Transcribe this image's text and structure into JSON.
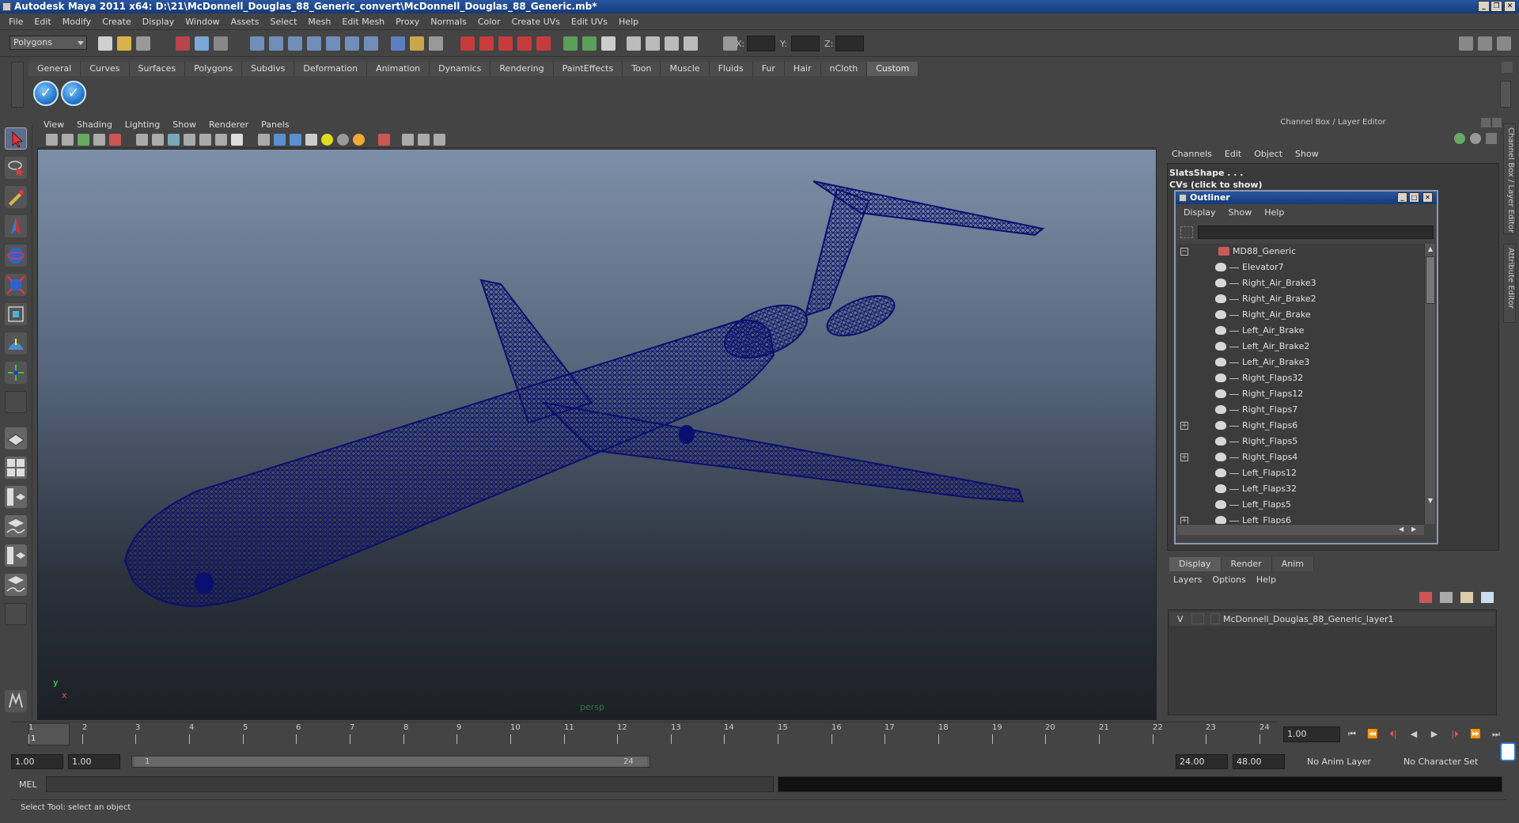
{
  "window": {
    "title": "Autodesk Maya 2011 x64: D:\\21\\McDonnell_Douglas_88_Generic_convert\\McDonnell_Douglas_88_Generic.mb*",
    "min": "_",
    "max": "❐",
    "close": "✕"
  },
  "menubar": [
    "File",
    "Edit",
    "Modify",
    "Create",
    "Display",
    "Window",
    "Assets",
    "Select",
    "Mesh",
    "Edit Mesh",
    "Proxy",
    "Normals",
    "Color",
    "Create UVs",
    "Edit UVs",
    "Help"
  ],
  "statusline": {
    "mode": "Polygons",
    "x_label": "X:",
    "y_label": "Y:",
    "z_label": "Z:"
  },
  "shelf": {
    "tabs": [
      "General",
      "Curves",
      "Surfaces",
      "Polygons",
      "Subdivs",
      "Deformation",
      "Animation",
      "Dynamics",
      "Rendering",
      "PaintEffects",
      "Toon",
      "Muscle",
      "Fluids",
      "Fur",
      "Hair",
      "nCloth",
      "Custom"
    ],
    "active_tab": "Custom",
    "button_glyph": "✓"
  },
  "viewport": {
    "menu": [
      "View",
      "Shading",
      "Lighting",
      "Show",
      "Renderer",
      "Panels"
    ],
    "camera_label": "persp",
    "axis_y": "y",
    "axis_x": "x"
  },
  "channel_box": {
    "title": "Channel Box / Layer Editor",
    "menu": [
      "Channels",
      "Edit",
      "Object",
      "Show"
    ],
    "object_name": "SlatsShape . . .",
    "cvs_text": "CVs (click to show)"
  },
  "outliner": {
    "title": "Outliner",
    "menu": [
      "Display",
      "Show",
      "Help"
    ],
    "items": [
      {
        "label": "MD88_Generic",
        "expander": "−",
        "root": true
      },
      {
        "label": "Elevator7",
        "expander": ""
      },
      {
        "label": "Right_Air_Brake3",
        "expander": ""
      },
      {
        "label": "Right_Air_Brake2",
        "expander": ""
      },
      {
        "label": "Right_Air_Brake",
        "expander": ""
      },
      {
        "label": "Left_Air_Brake",
        "expander": ""
      },
      {
        "label": "Left_Air_Brake2",
        "expander": ""
      },
      {
        "label": "Left_Air_Brake3",
        "expander": ""
      },
      {
        "label": "Right_Flaps32",
        "expander": ""
      },
      {
        "label": "Right_Flaps12",
        "expander": ""
      },
      {
        "label": "Right_Flaps7",
        "expander": ""
      },
      {
        "label": "Right_Flaps6",
        "expander": "+"
      },
      {
        "label": "Right_Flaps5",
        "expander": ""
      },
      {
        "label": "Right_Flaps4",
        "expander": "+"
      },
      {
        "label": "Left_Flaps12",
        "expander": ""
      },
      {
        "label": "Left_Flaps32",
        "expander": ""
      },
      {
        "label": "Left_Flaps5",
        "expander": ""
      },
      {
        "label": "Left_Flaps6",
        "expander": "+"
      }
    ]
  },
  "layer_editor": {
    "tabs": [
      "Display",
      "Render",
      "Anim"
    ],
    "active_tab": "Display",
    "menu": [
      "Layers",
      "Options",
      "Help"
    ],
    "layer_visibility": "V",
    "layer_name": "McDonnell_Douglas_88_Generic_layer1"
  },
  "side_tabs": [
    "Channel Box / Layer Editor",
    "Attribute Editor"
  ],
  "timeline": {
    "ticks": [
      "1",
      "2",
      "3",
      "4",
      "5",
      "6",
      "7",
      "8",
      "9",
      "10",
      "11",
      "12",
      "13",
      "14",
      "15",
      "16",
      "17",
      "18",
      "19",
      "20",
      "21",
      "22",
      "23",
      "24"
    ],
    "current_frame_marker": "1",
    "current_frame": "1.00",
    "playback": [
      "⏮",
      "⏪",
      "⏴|",
      "◀",
      "▶",
      "|⏵",
      "⏩",
      "⏭"
    ]
  },
  "range": {
    "start_time": "1.00",
    "playback_start": "1.00",
    "slider_start": "1",
    "slider_end": "24",
    "playback_end": "24.00",
    "end_time": "48.00",
    "anim_layer": "No Anim Layer",
    "character_set": "No Character Set"
  },
  "command_line": {
    "label": "MEL"
  },
  "help_line": {
    "text": "Select Tool: select an object"
  },
  "colors": {
    "wireframe": "#0b0f6e",
    "title_bar": "#1f4b94",
    "panel": "#444444"
  }
}
